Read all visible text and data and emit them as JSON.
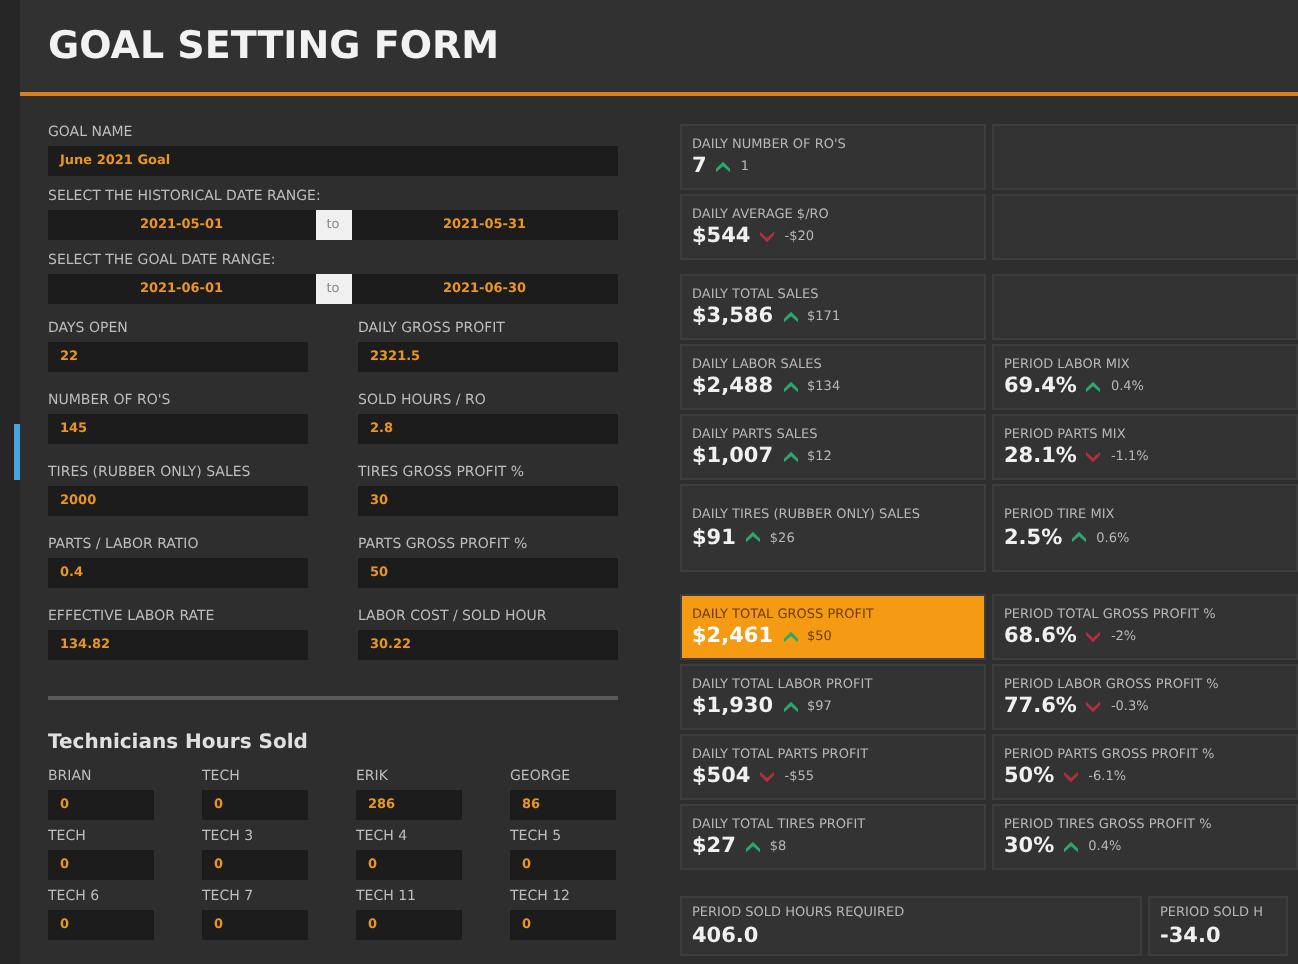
{
  "title": "GOAL SETTING FORM",
  "goal_name": {
    "label": "GOAL NAME",
    "value": "June 2021 Goal"
  },
  "date_ranges": [
    {
      "label": "SELECT THE HISTORICAL DATE RANGE:",
      "from": "2021-05-01",
      "separator": "to",
      "to": "2021-05-31"
    },
    {
      "label": "SELECT THE GOAL DATE RANGE:",
      "from": "2021-06-01",
      "separator": "to",
      "to": "2021-06-30"
    }
  ],
  "fields": [
    {
      "label": "DAYS OPEN",
      "value": "22"
    },
    {
      "label": "DAILY GROSS PROFIT",
      "value": "2321.5"
    },
    {
      "label": "NUMBER OF RO'S",
      "value": "145"
    },
    {
      "label": "SOLD HOURS / RO",
      "value": "2.8"
    },
    {
      "label": "TIRES (RUBBER ONLY) SALES",
      "value": "2000"
    },
    {
      "label": "TIRES GROSS PROFIT %",
      "value": "30"
    },
    {
      "label": "PARTS / LABOR RATIO",
      "value": "0.4"
    },
    {
      "label": "PARTS GROSS PROFIT %",
      "value": "50"
    },
    {
      "label": "EFFECTIVE LABOR RATE",
      "value": "134.82"
    },
    {
      "label": "LABOR COST / SOLD HOUR",
      "value": "30.22"
    }
  ],
  "technicians": {
    "title": "Technicians Hours Sold",
    "items": [
      {
        "label": "BRIAN",
        "value": "0"
      },
      {
        "label": "TECH",
        "value": "0"
      },
      {
        "label": "ERIK",
        "value": "286"
      },
      {
        "label": "GEORGE",
        "value": "86"
      },
      {
        "label": "TECH",
        "value": "0"
      },
      {
        "label": "TECH 3",
        "value": "0"
      },
      {
        "label": "TECH 4",
        "value": "0"
      },
      {
        "label": "TECH 5",
        "value": "0"
      },
      {
        "label": "TECH 6",
        "value": "0"
      },
      {
        "label": "TECH 7",
        "value": "0"
      },
      {
        "label": "TECH 11",
        "value": "0"
      },
      {
        "label": "TECH 12",
        "value": "0"
      }
    ]
  },
  "metric_groups": [
    {
      "rows": [
        [
          {
            "kind": "metric",
            "label": "DAILY NUMBER OF RO'S",
            "value": "7",
            "rising": true,
            "delta": "1",
            "highlighted": false
          },
          {
            "kind": "blank"
          }
        ],
        [
          {
            "kind": "metric",
            "label": "DAILY AVERAGE $/RO",
            "value": "$544",
            "rising": false,
            "delta": "-$20",
            "highlighted": false
          },
          {
            "kind": "blank"
          }
        ]
      ]
    },
    {
      "rows": [
        [
          {
            "kind": "metric",
            "label": "DAILY TOTAL SALES",
            "value": "$3,586",
            "rising": true,
            "delta": "$171",
            "highlighted": false
          },
          {
            "kind": "blank"
          }
        ],
        [
          {
            "kind": "metric",
            "label": "DAILY LABOR SALES",
            "value": "$2,488",
            "rising": true,
            "delta": "$134",
            "highlighted": false
          },
          {
            "kind": "metric",
            "label": "PERIOD LABOR MIX",
            "value": "69.4%",
            "rising": true,
            "delta": "0.4%",
            "highlighted": false
          }
        ],
        [
          {
            "kind": "metric",
            "label": "DAILY PARTS SALES",
            "value": "$1,007",
            "rising": true,
            "delta": "$12",
            "highlighted": false
          },
          {
            "kind": "metric",
            "label": "PERIOD PARTS MIX",
            "value": "28.1%",
            "rising": false,
            "delta": "-1.1%",
            "highlighted": false
          }
        ],
        [
          {
            "kind": "metric",
            "label": "DAILY TIRES (RUBBER ONLY) SALES",
            "value": "$91",
            "rising": true,
            "delta": "$26",
            "highlighted": false
          },
          {
            "kind": "metric",
            "label": "PERIOD TIRE MIX",
            "value": "2.5%",
            "rising": true,
            "delta": "0.6%",
            "highlighted": false
          }
        ]
      ]
    },
    {
      "rows": [
        [
          {
            "kind": "metric",
            "label": "DAILY TOTAL GROSS PROFIT",
            "value": "$2,461",
            "rising": true,
            "delta": "$50",
            "highlighted": true
          },
          {
            "kind": "metric",
            "label": "PERIOD TOTAL GROSS PROFIT %",
            "value": "68.6%",
            "rising": false,
            "delta": "-2%",
            "highlighted": false
          }
        ],
        [
          {
            "kind": "metric",
            "label": "DAILY TOTAL LABOR PROFIT",
            "value": "$1,930",
            "rising": true,
            "delta": "$97",
            "highlighted": false
          },
          {
            "kind": "metric",
            "label": "PERIOD LABOR GROSS PROFIT %",
            "value": "77.6%",
            "rising": false,
            "delta": "-0.3%",
            "highlighted": false
          }
        ],
        [
          {
            "kind": "metric",
            "label": "DAILY TOTAL PARTS PROFIT",
            "value": "$504",
            "rising": false,
            "delta": "-$55",
            "highlighted": false
          },
          {
            "kind": "metric",
            "label": "PERIOD PARTS GROSS PROFIT %",
            "value": "50%",
            "rising": false,
            "delta": "-6.1%",
            "highlighted": false
          }
        ],
        [
          {
            "kind": "metric",
            "label": "DAILY TOTAL TIRES PROFIT",
            "value": "$27",
            "rising": true,
            "delta": "$8",
            "highlighted": false
          },
          {
            "kind": "metric",
            "label": "PERIOD TIRES GROSS PROFIT %",
            "value": "30%",
            "rising": true,
            "delta": "0.4%",
            "highlighted": false
          }
        ]
      ]
    }
  ],
  "summary": [
    {
      "label": "PERIOD SOLD HOURS REQUIRED",
      "value": "406.0"
    },
    {
      "label": "PERIOD SOLD H",
      "value": "-34.0"
    }
  ]
}
